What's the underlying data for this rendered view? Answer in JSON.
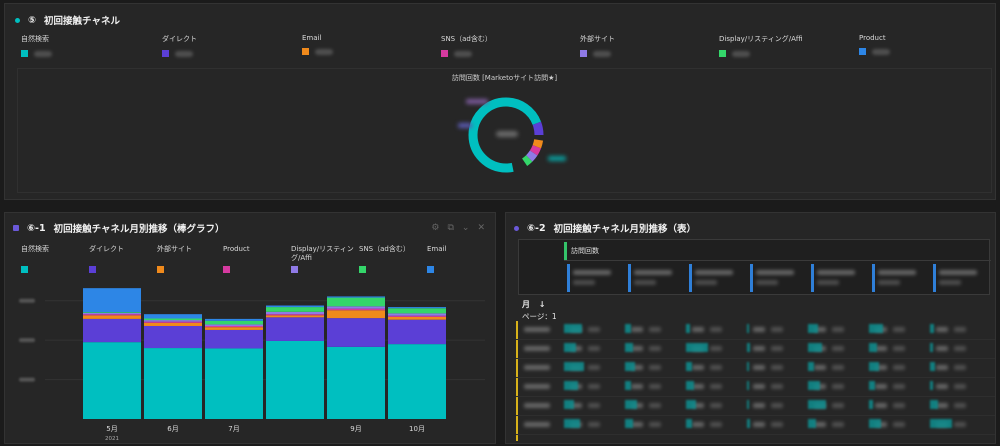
{
  "panel5": {
    "number": "⑤",
    "title": "初回接触チャネル",
    "legend": [
      {
        "label": "自然検索",
        "color": "#00bfc0"
      },
      {
        "label": "ダイレクト",
        "color": "#5b3fd6"
      },
      {
        "label": "Email",
        "color": "#f08a1c"
      },
      {
        "label": "SNS（ad含む）",
        "color": "#d63aa0"
      },
      {
        "label": "外部サイト",
        "color": "#8f7ae6"
      },
      {
        "label": "Display/リスティング/Affi",
        "color": "#34d66a"
      },
      {
        "label": "Product",
        "color": "#2d86e6"
      }
    ],
    "donut_title": "訪問回数 [Marketoサイト訪問★]"
  },
  "panel61": {
    "number": "⑥-1",
    "title": "初回接触チャネル月別推移（棒グラフ）",
    "legend": [
      {
        "label": "自然検索",
        "color": "#00bfc0"
      },
      {
        "label": "ダイレクト",
        "color": "#5b3fd6"
      },
      {
        "label": "外部サイト",
        "color": "#f08a1c"
      },
      {
        "label": "Product",
        "color": "#d63aa0"
      },
      {
        "label": "Display/リスティング/Affi",
        "color": "#8f7ae6"
      },
      {
        "label": "SNS（ad含む）",
        "color": "#34d66a"
      },
      {
        "label": "Email",
        "color": "#2d86e6"
      }
    ]
  },
  "chart_data": {
    "type": "bar",
    "stacked": true,
    "categories": [
      "5月",
      "6月",
      "7月",
      "",
      "9月",
      "10月"
    ],
    "year_label": "2021",
    "series": [
      {
        "name": "自然検索",
        "color": "#00bfc0",
        "values": [
          1950,
          1800,
          1790,
          1980,
          1830,
          1900
        ]
      },
      {
        "name": "ダイレクト",
        "color": "#5b3fd6",
        "values": [
          590,
          560,
          470,
          600,
          730,
          620
        ]
      },
      {
        "name": "外部サイト",
        "color": "#f08a1c",
        "values": [
          90,
          80,
          70,
          50,
          200,
          70
        ]
      },
      {
        "name": "Product",
        "color": "#d63aa0",
        "values": [
          30,
          30,
          30,
          30,
          40,
          30
        ]
      },
      {
        "name": "Display/リスティング/Affi",
        "color": "#8f7ae6",
        "values": [
          30,
          40,
          40,
          60,
          60,
          60
        ]
      },
      {
        "name": "SNS（ad含む）",
        "color": "#34d66a",
        "values": [
          20,
          40,
          90,
          120,
          220,
          130
        ]
      },
      {
        "name": "Email",
        "color": "#2d86e6",
        "values": [
          610,
          110,
          50,
          40,
          30,
          30
        ]
      }
    ],
    "ylim": [
      0,
      3400
    ],
    "grid": true
  },
  "panel62": {
    "number": "⑥-2",
    "title": "初回接触チャネル月別推移（表）",
    "metric_header": "訪問回数",
    "row_dim": "月",
    "sort_arrow": "↓",
    "page_label": "ページ：1"
  }
}
